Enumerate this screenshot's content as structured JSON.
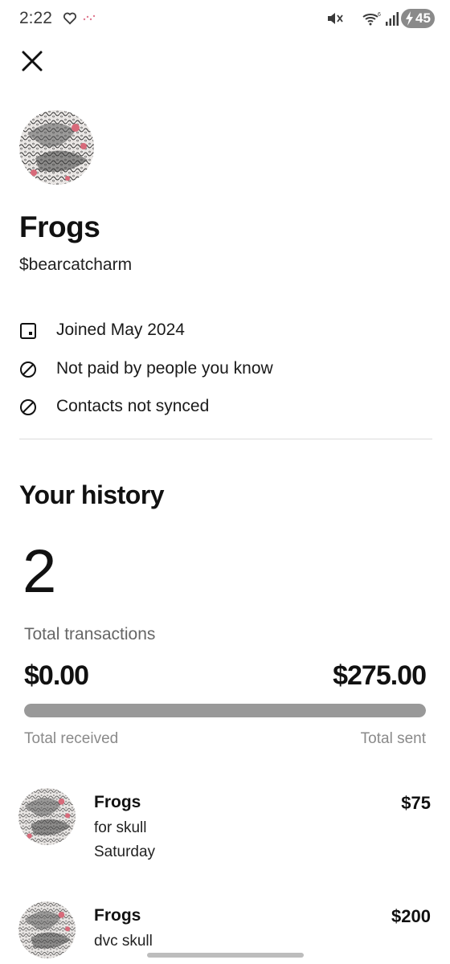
{
  "status_bar": {
    "time": "2:22",
    "battery": "45",
    "icons": [
      "heart-icon",
      "notification-dots-icon",
      "mute-icon",
      "wifi-icon",
      "signal-icon",
      "battery-icon"
    ]
  },
  "header": {
    "close_icon": "close-icon"
  },
  "profile": {
    "name": "Frogs",
    "handle": "$bearcatcharm",
    "details": [
      {
        "icon": "calendar-icon",
        "text": "Joined May 2024"
      },
      {
        "icon": "blocked-icon",
        "text": "Not paid by people you know"
      },
      {
        "icon": "blocked-icon",
        "text": "Contacts not synced"
      }
    ]
  },
  "history": {
    "title": "Your history",
    "count": "2",
    "count_label": "Total transactions",
    "received_amount": "$0.00",
    "sent_amount": "$275.00",
    "received_label": "Total received",
    "sent_label": "Total sent",
    "sent_fraction": 1.0
  },
  "transactions": [
    {
      "name": "Frogs",
      "note": "for skull",
      "date": "Saturday",
      "amount": "$75"
    },
    {
      "name": "Frogs",
      "note": "dvc skull",
      "date": "",
      "amount": "$200"
    }
  ],
  "colors": {
    "text": "#111111",
    "muted": "#8a8a8a",
    "progress_fill": "#999999",
    "progress_track": "#e6e6e6",
    "accent_pink": "#d86a7a"
  }
}
